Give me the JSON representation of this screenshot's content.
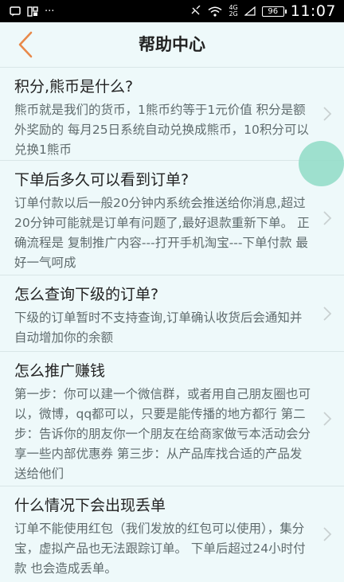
{
  "status_bar": {
    "left_icons": [
      "message-icon",
      "notification-icon",
      "more-icon"
    ],
    "more_text": "···",
    "network_top": "4G",
    "network_bottom": "2G",
    "battery": "96",
    "time": "11:07"
  },
  "header": {
    "back_icon": "chevron-left-icon",
    "title": "帮助中心",
    "accent_color": "#e8894a"
  },
  "faq": [
    {
      "question": "积分,熊币是什么?",
      "answer": "熊币就是我们的货币，1熊币约等于1元价值 积分是额外奖励的 每月25日系统自动兑换成熊币，10积分可以兑换1熊币"
    },
    {
      "question": "下单后多久可以看到订单?",
      "answer": "订单付款以后一般20分钟内系统会推送给你消息,超过20分钟可能就是订单有问题了,最好退款重新下单。 正确流程是 复制推广内容---打开手机淘宝---下单付款 最好一气呵成"
    },
    {
      "question": "怎么查询下级的订单?",
      "answer": "下级的订单暂时不支持查询,订单确认收货后会通知并自动增加你的余额"
    },
    {
      "question": "怎么推广赚钱",
      "answer": "第一步：你可以建一个微信群，或者用自己朋友圈也可以，微博，qq都可以，只要是能传播的地方都行 第二步：告诉你的朋友你一个朋友在给商家做亏本活动会分享一些内部优惠券 第三步：从产品库找合适的产品发送给他们"
    },
    {
      "question": "什么情况下会出现丢单",
      "answer": "订单不能使用红包（我们发放的红包可以使用），集分宝，虚拟产品也无法跟踪订单。 下单后超过24小时付款 也会造成丢单。"
    }
  ]
}
